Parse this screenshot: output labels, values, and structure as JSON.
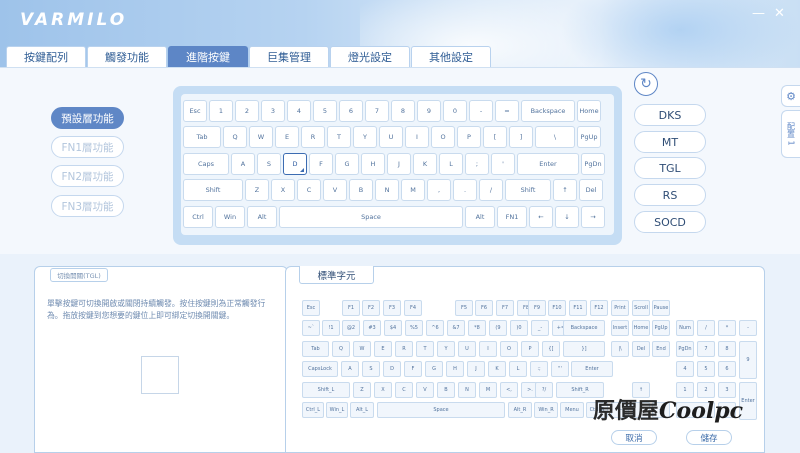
{
  "app": {
    "logo": "VARMILO",
    "min_label": "—",
    "close_label": "✕"
  },
  "tabs": [
    "按鍵配列",
    "觸發功能",
    "進階按鍵",
    "巨集管理",
    "燈光設定",
    "其他設定"
  ],
  "active_tab": 2,
  "layers": [
    "預設層功能",
    "FN1層功能",
    "FN2層功能",
    "FN3層功能"
  ],
  "active_layer": 0,
  "keyboard": {
    "selected": "D",
    "rows": [
      [
        "Esc",
        "1",
        "2",
        "3",
        "4",
        "5",
        "6",
        "7",
        "8",
        "9",
        "0",
        "-",
        "=",
        "Backspace",
        "Home"
      ],
      [
        "Tab",
        "Q",
        "W",
        "E",
        "R",
        "T",
        "Y",
        "U",
        "I",
        "O",
        "P",
        "[",
        "]",
        "\\",
        "PgUp"
      ],
      [
        "Caps",
        "A",
        "S",
        "D",
        "F",
        "G",
        "H",
        "J",
        "K",
        "L",
        ";",
        "'",
        "Enter",
        "PgDn"
      ],
      [
        "Shift",
        "Z",
        "X",
        "C",
        "V",
        "B",
        "N",
        "M",
        ",",
        ".",
        "/",
        "Shift",
        "↑",
        "Del"
      ],
      [
        "Ctrl",
        "Win",
        "Alt",
        "Space",
        "Alt",
        "FN1",
        "←",
        "↓",
        "→"
      ]
    ]
  },
  "functions": [
    "DKS",
    "MT",
    "TGL",
    "RS",
    "SOCD"
  ],
  "refresh_icon": "↻",
  "side": {
    "gear_icon": "⚙",
    "tab_label": "配置 1"
  },
  "description": {
    "title": "切換開關(TGL)",
    "text": "單擊按鍵可切換開啟或關閉持續觸發。按住按鍵則為正常觸發行為。拖放按鍵到您想要的鍵位上即可綁定切換開關鍵。"
  },
  "standard": {
    "title": "標準字元",
    "rows": [
      [
        "Esc",
        "F1",
        "F2",
        "F3",
        "F4",
        "F5",
        "F6",
        "F7",
        "F8",
        "F9",
        "F10",
        "F11",
        "F12",
        "Print",
        "Scroll",
        "Pause"
      ],
      [
        "~`",
        "!1",
        "@2",
        "#3",
        "$4",
        "%5",
        "^6",
        "&7",
        "*8",
        "(9",
        ")0",
        "_-",
        "+=",
        "Backspace",
        "Insert",
        "Home",
        "PgUp",
        "Num",
        "/",
        "*",
        "-"
      ],
      [
        "Tab",
        "Q",
        "W",
        "E",
        "R",
        "T",
        "Y",
        "U",
        "I",
        "O",
        "P",
        "{[",
        "}]",
        "|\\",
        "Del",
        "End",
        "PgDn",
        "7",
        "8",
        "9",
        "+"
      ],
      [
        "CapsLock",
        "A",
        "S",
        "D",
        "F",
        "G",
        "H",
        "J",
        "K",
        "L",
        ":;",
        "\"'",
        "Enter",
        "4",
        "5",
        "6"
      ],
      [
        "Shift_L",
        "Z",
        "X",
        "C",
        "V",
        "B",
        "N",
        "M",
        "<,",
        ">.",
        "?/",
        "Shift_R",
        "↑",
        "1",
        "2",
        "3",
        "Enter"
      ],
      [
        "Ctrl_L",
        "Win_L",
        "Alt_L",
        "Space",
        "Alt_R",
        "Win_R",
        "Menu",
        "Ctrl_R",
        "←",
        "↓",
        "→",
        "0",
        "."
      ]
    ]
  },
  "buttons": {
    "cancel": "取消",
    "save": "儲存"
  },
  "watermark": {
    "cn": "原價屋",
    "brand": "Coolpc"
  }
}
